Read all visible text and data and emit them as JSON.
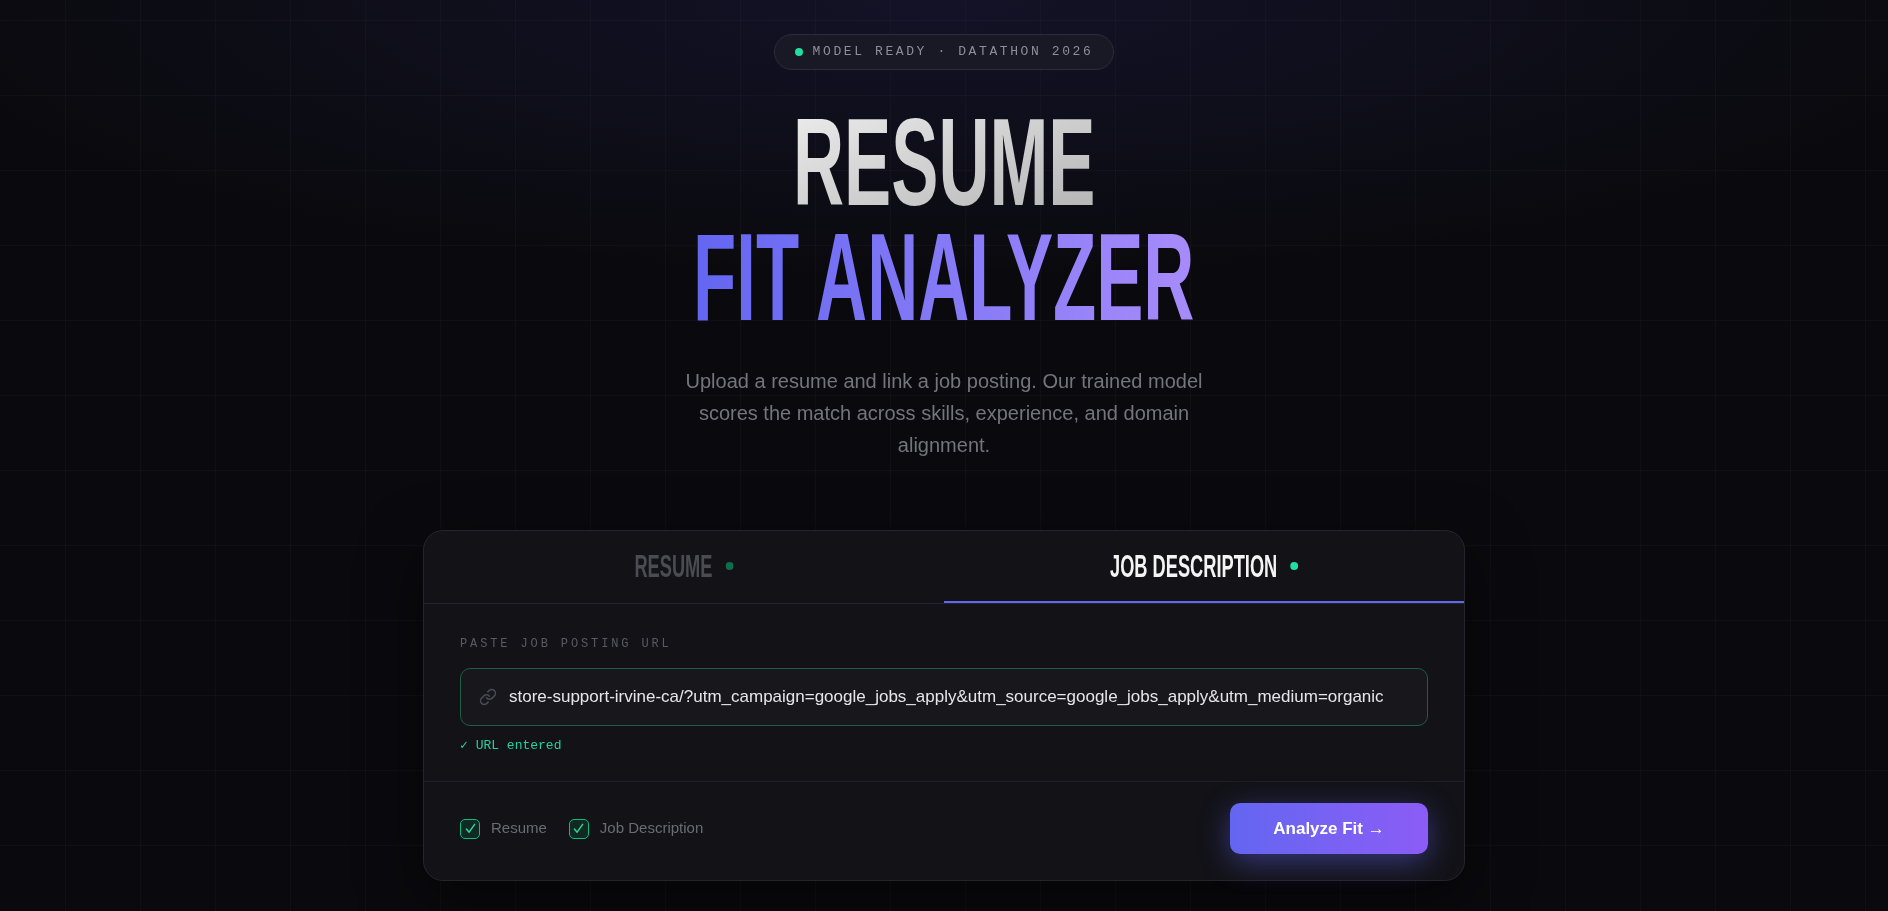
{
  "status_badge": {
    "text": "MODEL READY · DATATHON 2026"
  },
  "title": {
    "line_1": "RESUME",
    "line_2": "FIT ANALYZER"
  },
  "subtitle": "Upload a resume and link a job posting. Our trained model scores the match across skills, experience, and domain alignment.",
  "tabs": [
    {
      "label": "RESUME",
      "selected": false,
      "complete": true
    },
    {
      "label": "JOB DESCRIPTION",
      "selected": true,
      "complete": true
    }
  ],
  "url_input": {
    "label": "PASTE JOB POSTING URL",
    "value": "store-support-irvine-ca/?utm_campaign=google_jobs_apply&utm_source=google_jobs_apply&utm_medium=organic",
    "valid": true,
    "status": "✓ URL entered"
  },
  "checklist": [
    {
      "label": "Resume",
      "checked": true
    },
    {
      "label": "Job Description",
      "checked": true
    }
  ],
  "analyze_button": {
    "label": "Analyze Fit →"
  }
}
